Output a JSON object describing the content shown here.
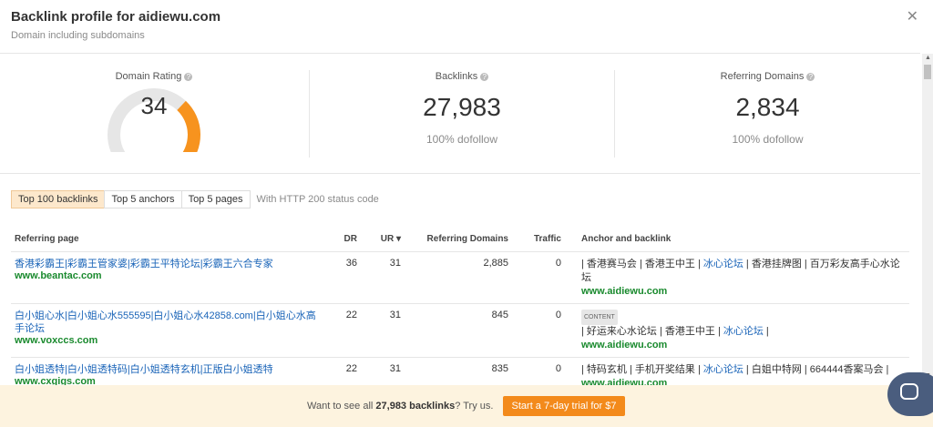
{
  "header": {
    "title": "Backlink profile for aidiewu.com",
    "subtitle": "Domain including subdomains",
    "close_icon": "close-icon"
  },
  "stats": {
    "domain_rating": {
      "label": "Domain Rating",
      "value": "34",
      "fill_fraction": 0.34,
      "accent": "#f7931e",
      "track": "#e6e6e6"
    },
    "backlinks": {
      "label": "Backlinks",
      "value": "27,983",
      "sub": "100% dofollow"
    },
    "referring_domains": {
      "label": "Referring Domains",
      "value": "2,834",
      "sub": "100% dofollow"
    },
    "help_icon": "?"
  },
  "tabs": {
    "items": [
      "Top 100 backlinks",
      "Top 5 anchors",
      "Top 5 pages"
    ],
    "active": 0,
    "note": "With HTTP 200 status code"
  },
  "table": {
    "headers": {
      "referring_page": "Referring page",
      "dr": "DR",
      "ur": "UR ▾",
      "ref_domains": "Referring Domains",
      "traffic": "Traffic",
      "anchor": "Anchor and backlink"
    },
    "rows": [
      {
        "title": "香港彩霸王|彩霸王管家婆|彩霸王平特论坛|彩霸王六合专家",
        "domain": "www.beantac.com",
        "dr": "36",
        "ur": "31",
        "refdomains": "2,885",
        "traffic": "0",
        "badge": "",
        "anchor_a": "| 香港赛马会 | 香港王中王 | ",
        "anchor_link": "冰心论坛",
        "anchor_b": " | 香港挂牌图 | 百万彩友高手心水论坛",
        "backlink": "www.aidiewu.com"
      },
      {
        "title": "白小姐心水|白小姐心水555595|白小姐心水42858.com|白小姐心水高手论坛",
        "domain": "www.voxccs.com",
        "dr": "22",
        "ur": "31",
        "refdomains": "845",
        "traffic": "0",
        "badge": "CONTENT",
        "anchor_a": "| 好运来心水论坛 | 香港王中王 | ",
        "anchor_link": "冰心论坛",
        "anchor_b": " |",
        "backlink": "www.aidiewu.com"
      },
      {
        "title": "白小姐透特|白小姐透特码|白小姐透特玄机|正版白小姐透特",
        "domain": "www.cxgigs.com",
        "dr": "22",
        "ur": "31",
        "refdomains": "835",
        "traffic": "0",
        "badge": "",
        "anchor_a": "| 特码玄机 | 手机开奖结果 | ",
        "anchor_link": "冰心论坛",
        "anchor_b": " | 白姐中特网 | 664444香案马会 |",
        "backlink": "www.aidiewu.com"
      }
    ]
  },
  "footer": {
    "text_before": "Want to see all ",
    "text_bold": "27,983 backlinks",
    "text_after": "? Try us.",
    "cta": "Start a 7-day trial for $7"
  },
  "chat": {
    "icon": "chat-icon"
  }
}
